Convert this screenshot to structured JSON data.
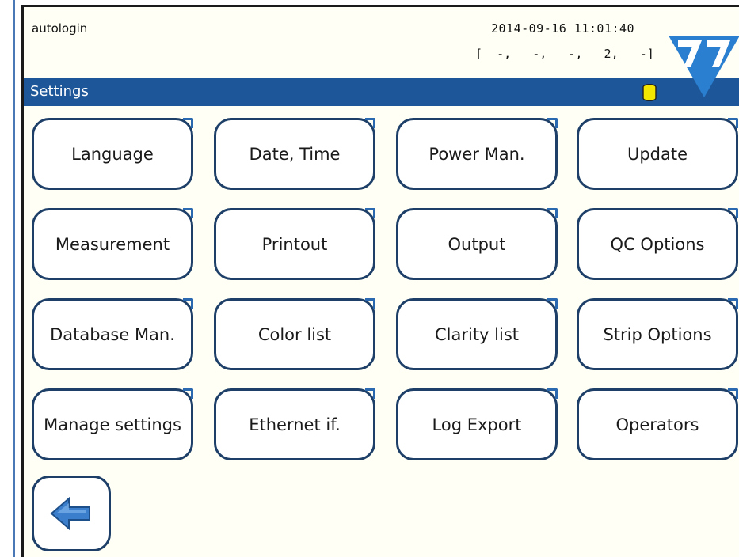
{
  "status_bar": {
    "user": "autologin",
    "datetime": "2014-09-16 11:01:40",
    "codes": "[  -,   -,   -,   2,   -]"
  },
  "titlebar": {
    "title": "Settings"
  },
  "colors": {
    "titlebar": "#1e5799",
    "button_border": "#1d3f68",
    "screen_background": "#fffff5",
    "db_icon": "#f3e600",
    "back_arrow": "#3b7fcc"
  },
  "menu": [
    {
      "label": "Language"
    },
    {
      "label": "Date, Time"
    },
    {
      "label": "Power Man."
    },
    {
      "label": "Update"
    },
    {
      "label": "Measurement"
    },
    {
      "label": "Printout"
    },
    {
      "label": "Output"
    },
    {
      "label": "QC Options"
    },
    {
      "label": "Database Man."
    },
    {
      "label": "Color list"
    },
    {
      "label": "Clarity list"
    },
    {
      "label": "Strip Options"
    },
    {
      "label": "Manage settings"
    },
    {
      "label": "Ethernet if."
    },
    {
      "label": "Log Export"
    },
    {
      "label": "Operators"
    }
  ],
  "icons": {
    "database": "database-icon",
    "logo": "brand-logo",
    "back": "back-arrow-icon"
  }
}
